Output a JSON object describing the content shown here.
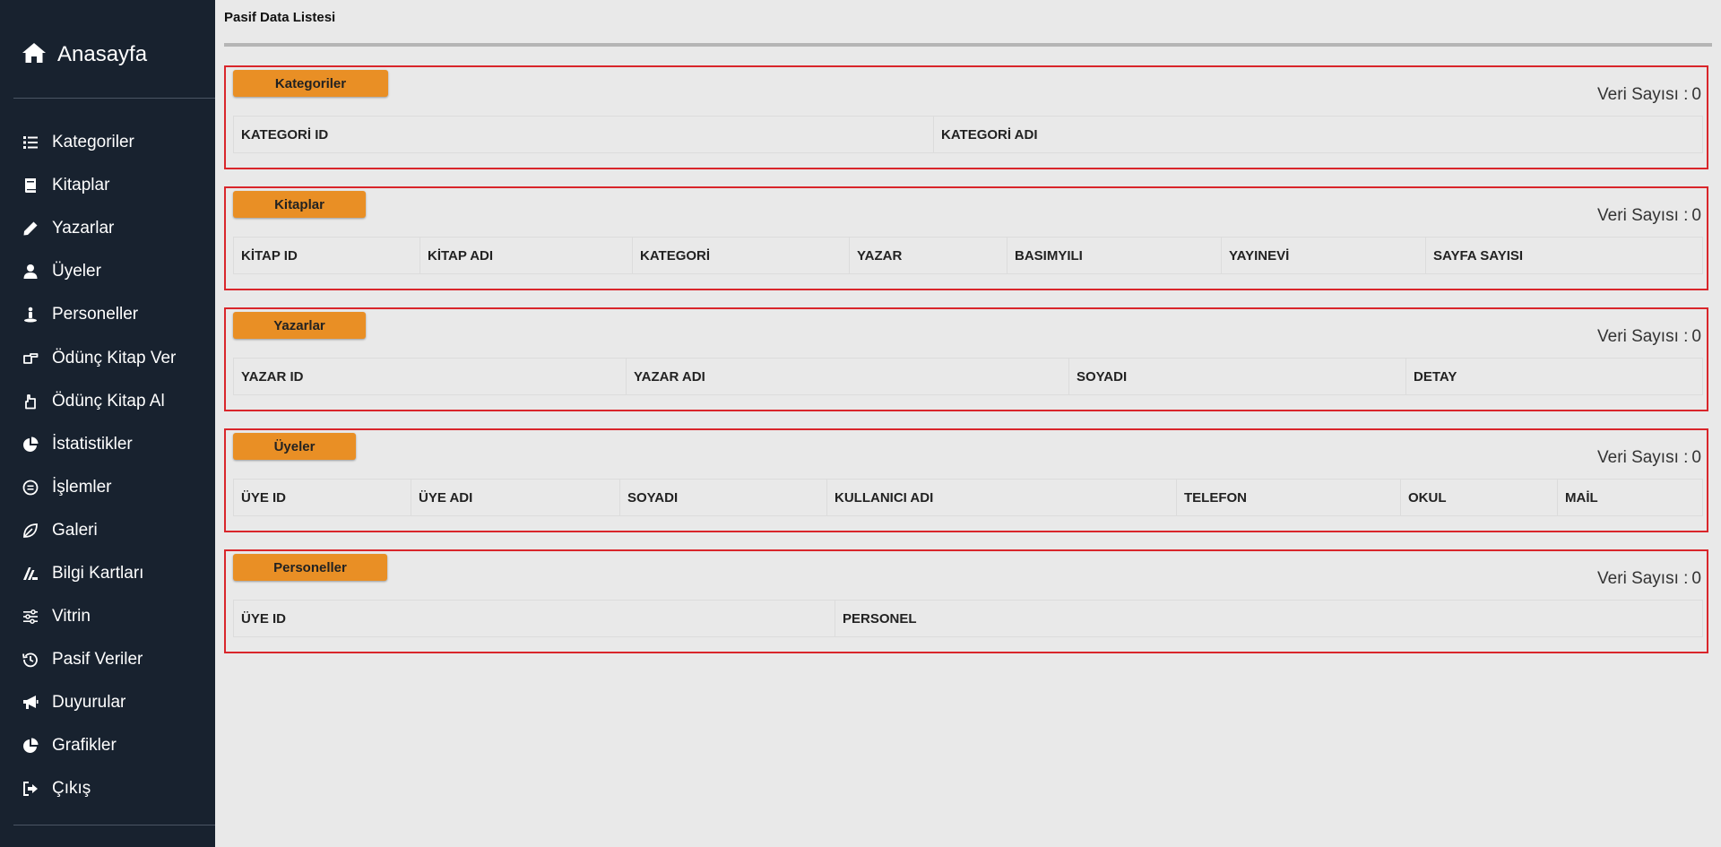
{
  "sidebar": {
    "brand": {
      "label": "Anasayfa",
      "icon": "home-icon"
    },
    "items": [
      {
        "label": "Kategoriler",
        "icon": "list-icon"
      },
      {
        "label": "Kitaplar",
        "icon": "book-icon"
      },
      {
        "label": "Yazarlar",
        "icon": "pencil-icon"
      },
      {
        "label": "Üyeler",
        "icon": "user-icon"
      },
      {
        "label": "Personeller",
        "icon": "person-icon"
      },
      {
        "label": "Ödünç Kitap Ver",
        "icon": "hand-point-right-icon"
      },
      {
        "label": "Ödünç Kitap Al",
        "icon": "hand-point-left-icon"
      },
      {
        "label": "İstatistikler",
        "icon": "chart-pie-icon"
      },
      {
        "label": "İşlemler",
        "icon": "circle-equals-icon"
      },
      {
        "label": "Galeri",
        "icon": "leaf-icon"
      },
      {
        "label": "Bilgi Kartları",
        "icon": "cards-icon"
      },
      {
        "label": "Vitrin",
        "icon": "sliders-icon"
      },
      {
        "label": "Pasif Veriler",
        "icon": "history-icon"
      },
      {
        "label": "Duyurular",
        "icon": "megaphone-icon"
      },
      {
        "label": "Grafikler",
        "icon": "chart-pie-icon"
      },
      {
        "label": "Çıkış",
        "icon": "sign-out-icon"
      }
    ]
  },
  "main": {
    "title": "Pasif Data Listesi",
    "count_label": "Veri Sayısı :",
    "panels": [
      {
        "tag": "Kategoriler",
        "count": "0",
        "columns": [
          "KATEGORİ ID",
          "KATEGORİ ADI"
        ]
      },
      {
        "tag": "Kitaplar",
        "count": "0",
        "columns": [
          "KİTAP ID",
          "KİTAP ADI",
          "KATEGORİ",
          "YAZAR",
          "BASIMYILI",
          "YAYINEVİ",
          "SAYFA SAYISI"
        ]
      },
      {
        "tag": "Yazarlar",
        "count": "0",
        "columns": [
          "YAZAR ID",
          "YAZAR ADI",
          "SOYADI",
          "DETAY"
        ]
      },
      {
        "tag": "Üyeler",
        "count": "0",
        "columns": [
          "ÜYE ID",
          "ÜYE ADI",
          "SOYADI",
          "KULLANICI ADI",
          "TELEFON",
          "OKUL",
          "MAİL"
        ]
      },
      {
        "tag": "Personeller",
        "count": "0",
        "columns": [
          "ÜYE ID",
          "PERSONEL"
        ]
      }
    ]
  },
  "colors": {
    "sidebar_bg": "#18222f",
    "tag_orange": "#e98f25",
    "panel_border": "#d9262b"
  }
}
